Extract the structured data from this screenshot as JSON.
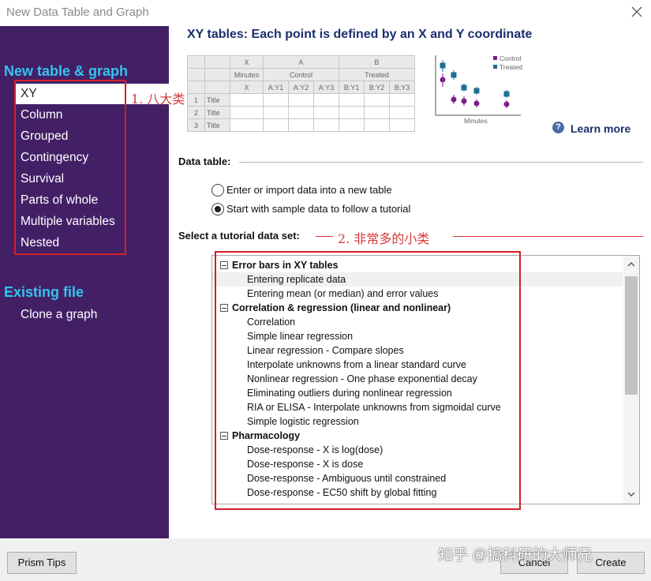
{
  "window": {
    "title": "New Data Table and Graph"
  },
  "sidebar": {
    "new_heading": "New table & graph",
    "items": [
      "XY",
      "Column",
      "Grouped",
      "Contingency",
      "Survival",
      "Parts of whole",
      "Multiple variables",
      "Nested"
    ],
    "selected": "XY",
    "existing_heading": "Existing file",
    "existing_items": [
      "Clone a graph"
    ]
  },
  "annotations": {
    "label1": "1. 八大类",
    "label2": "2. 非常多的小类",
    "color": "#d41e2a"
  },
  "main": {
    "heading": "XY tables: Each point is defined by an X and Y coordinate",
    "preview_table": {
      "x_col": "X",
      "group_a": "A",
      "group_b": "B",
      "x_sub": "Minutes",
      "a_sub": "Control",
      "b_sub": "Treated",
      "x_cell": "X",
      "a_cols": [
        "A:Y1",
        "A:Y2",
        "A:Y3"
      ],
      "b_cols": [
        "B:Y1",
        "B:Y2",
        "B:Y3"
      ],
      "rows": [
        {
          "num": "1",
          "title": "Title"
        },
        {
          "num": "2",
          "title": "Title"
        },
        {
          "num": "3",
          "title": "Title"
        }
      ]
    },
    "mini_chart": {
      "legend": [
        "Control",
        "Treated"
      ],
      "xlabel": "Minutes",
      "colors": {
        "control": "#7b1f8a",
        "treated": "#1d6f8f"
      }
    },
    "learn_more": "Learn more",
    "data_table_label": "Data table:",
    "radio_options": [
      {
        "label": "Enter or import data into a new table",
        "checked": false
      },
      {
        "label": "Start with sample data to follow a tutorial",
        "checked": true
      }
    ],
    "tutorial_label": "Select a tutorial data set:",
    "tutorial_groups": [
      {
        "name": "Error bars in XY tables",
        "items": [
          "Entering replicate data",
          "Entering mean (or median) and error values"
        ]
      },
      {
        "name": "Correlation & regression (linear and nonlinear)",
        "items": [
          "Correlation",
          "Simple linear regression",
          "Linear regression - Compare slopes",
          "Interpolate unknowns from a linear standard curve",
          "Nonlinear regression - One phase exponential decay",
          "Eliminating outliers during nonlinear regression",
          "RIA or ELISA - Interpolate unknowns from sigmoidal curve",
          "Simple logistic regression"
        ]
      },
      {
        "name": "Pharmacology",
        "items": [
          "Dose-response - X is log(dose)",
          "Dose-response - X is dose",
          "Dose-response - Ambiguous until constrained",
          "Dose-response - EC50 shift by global fitting"
        ]
      }
    ],
    "selected_item": "Entering replicate data"
  },
  "footer": {
    "tips_button": "Prism Tips",
    "cancel_button": "Cancel",
    "create_button": "Create",
    "watermark": "知乎 @搞科研的大师兄"
  }
}
